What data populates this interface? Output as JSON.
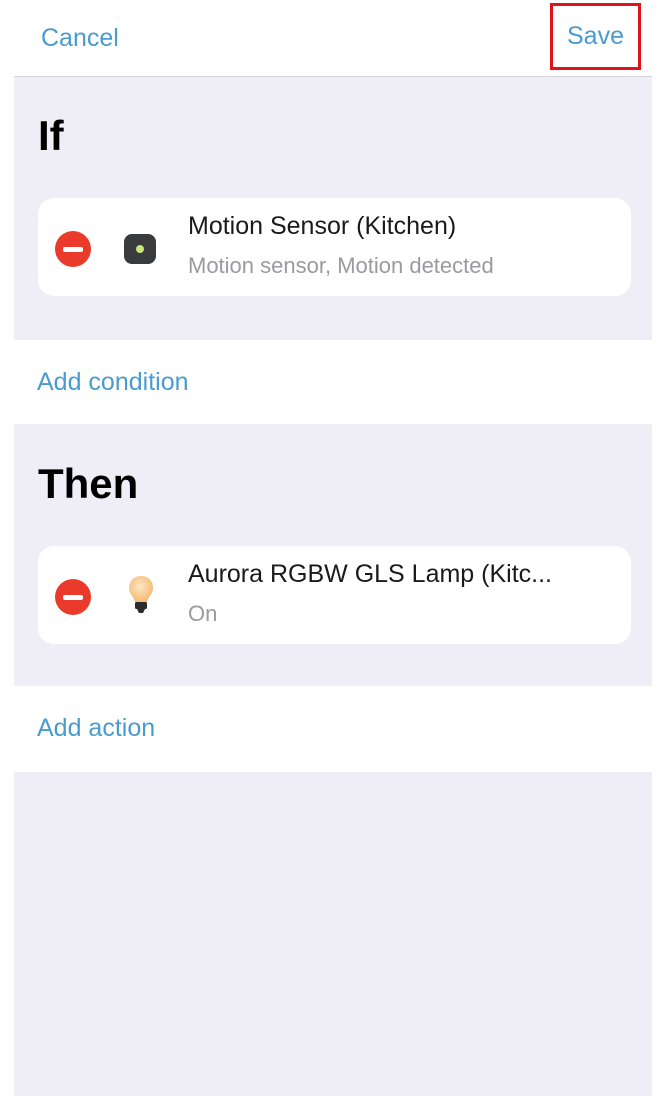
{
  "nav": {
    "cancel_label": "Cancel",
    "save_label": "Save"
  },
  "if_section": {
    "title": "If",
    "item": {
      "title": "Motion Sensor (Kitchen)",
      "subtitle": "Motion sensor, Motion detected",
      "icon": "motion-sensor-icon"
    },
    "add_label": "Add condition"
  },
  "then_section": {
    "title": "Then",
    "item": {
      "title": "Aurora RGBW GLS Lamp (Kitc...",
      "subtitle": "On",
      "icon": "light-bulb-icon"
    },
    "add_label": "Add action"
  },
  "colors": {
    "accent": "#4a9bd0",
    "remove": "#ea3a2c",
    "background": "#efedf5",
    "highlight_border": "#e0121b"
  }
}
